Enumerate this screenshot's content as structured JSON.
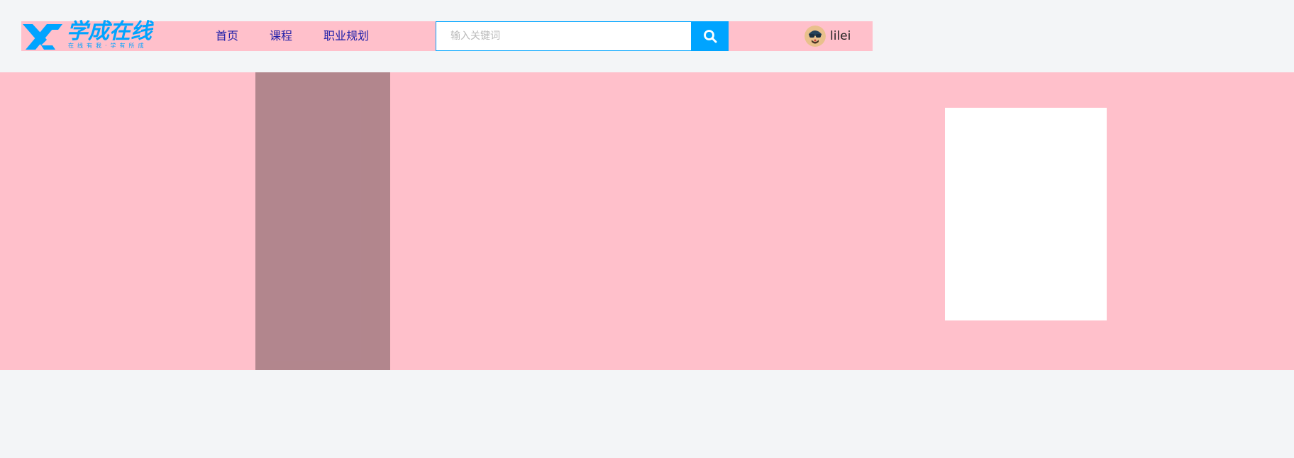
{
  "header": {
    "logo": {
      "title": "学成在线",
      "slogan": "在线有我·学有所成"
    },
    "nav": [
      {
        "label": "首页"
      },
      {
        "label": "课程"
      },
      {
        "label": "职业规划"
      }
    ],
    "search": {
      "placeholder": "输入关键词",
      "button_icon": "search-icon"
    },
    "user": {
      "avatar_icon": "user-avatar-icon",
      "name": "lilei"
    }
  },
  "colors": {
    "brand": "#00a4ff",
    "header_bg": "#ffc0cb",
    "banner_bg": "#ffc0cb",
    "page_bg": "#f3f5f7",
    "nav_text": "#1d1da8"
  }
}
